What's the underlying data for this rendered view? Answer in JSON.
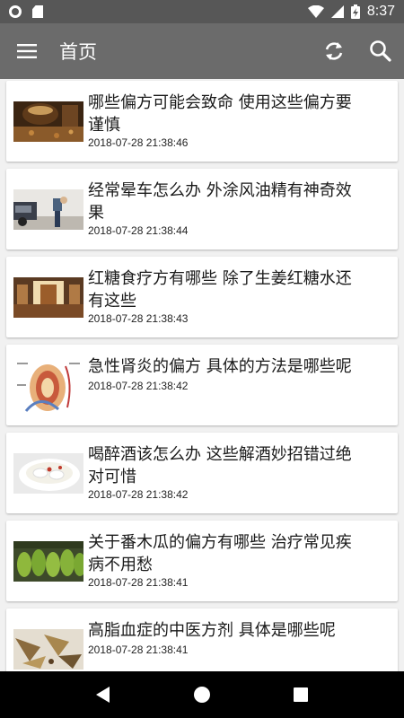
{
  "status_bar": {
    "time": "8:37",
    "icons": [
      "circle-notification-icon",
      "sd-card-icon",
      "wifi-icon",
      "signal-icon",
      "battery-charging-icon"
    ]
  },
  "app_bar": {
    "title": "首页",
    "menu_icon": "hamburger-menu-icon",
    "refresh_icon": "refresh-icon",
    "search_icon": "search-icon",
    "bar_color": "#6b6b6b"
  },
  "articles": [
    {
      "title": "哪些偏方可能会致命 使用这些偏方要谨慎",
      "time": "2018-07-28 21:38:46"
    },
    {
      "title": "经常晕车怎么办 外涂风油精有神奇效果",
      "time": "2018-07-28 21:38:44"
    },
    {
      "title": "红糖食疗方有哪些 除了生姜红糖水还有这些",
      "time": "2018-07-28 21:38:43"
    },
    {
      "title": "急性肾炎的偏方 具体的方法是哪些呢",
      "time": "2018-07-28 21:38:42"
    },
    {
      "title": "喝醉酒该怎么办 这些解酒妙招错过绝对可惜",
      "time": "2018-07-28 21:38:42"
    },
    {
      "title": "关于番木瓜的偏方有哪些 治疗常见疾病不用愁",
      "time": "2018-07-28 21:38:41"
    },
    {
      "title": "高脂血症的中医方剂 具体是哪些呢",
      "time": "2018-07-28 21:38:41"
    }
  ],
  "nav_bar": {
    "back_icon": "back-triangle-icon",
    "home_icon": "home-circle-icon",
    "recents_icon": "recents-square-icon"
  }
}
